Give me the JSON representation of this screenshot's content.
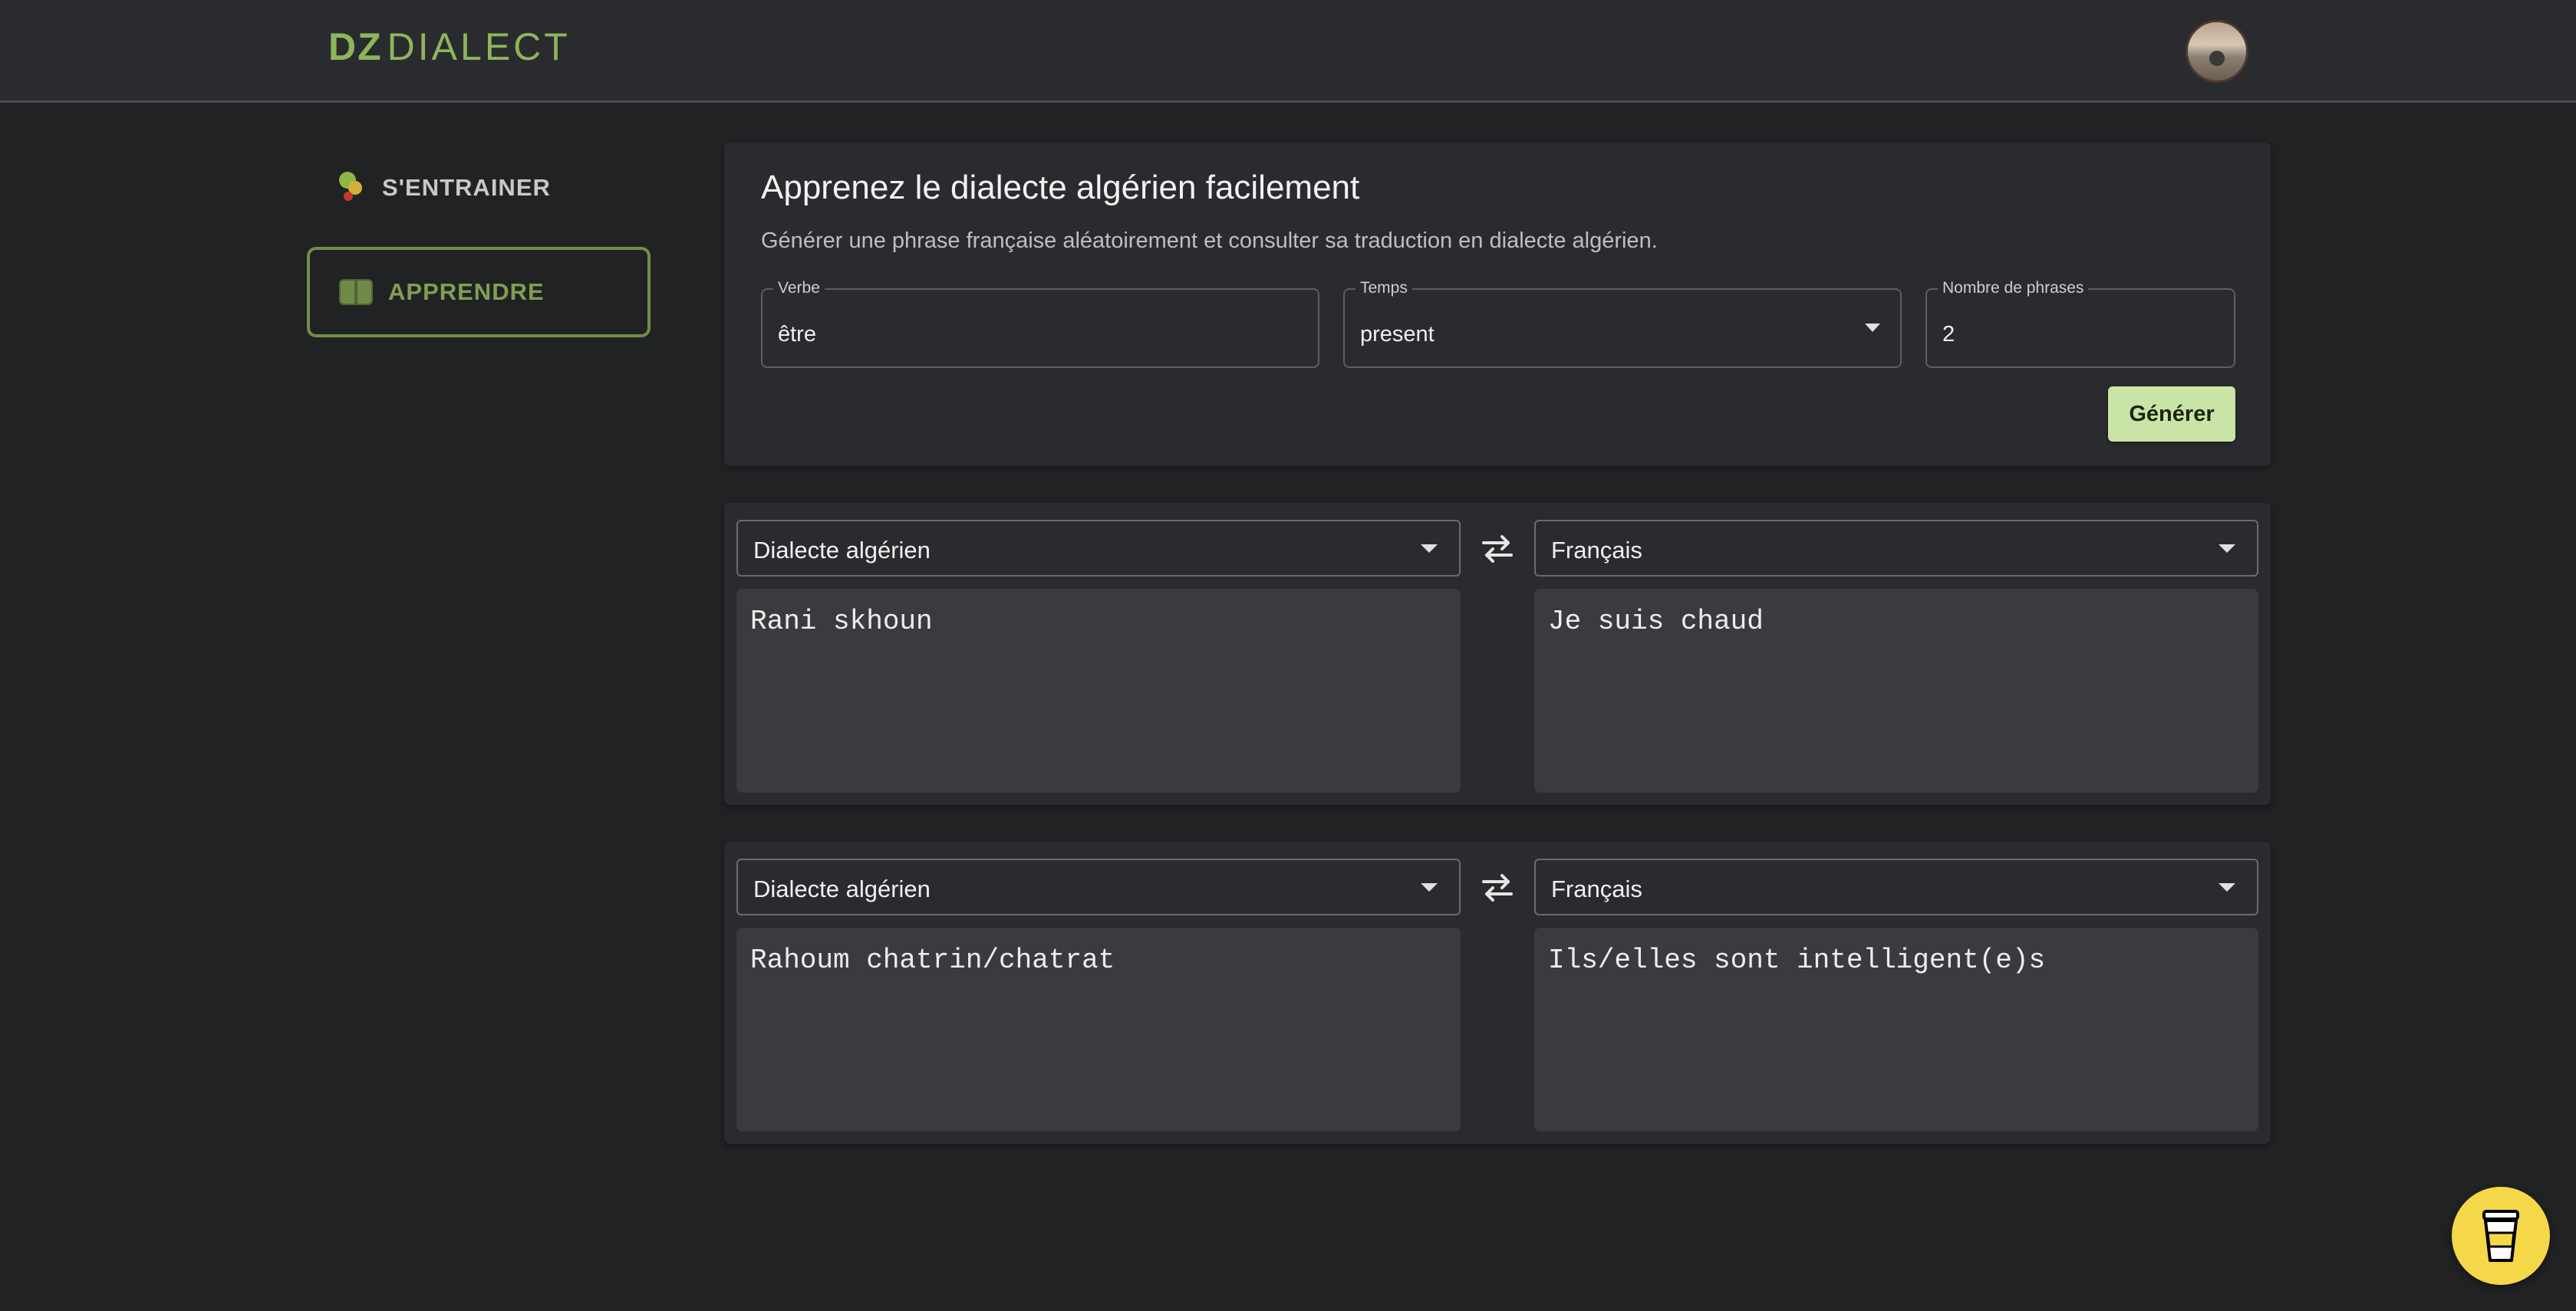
{
  "header": {
    "logo_dz": "DZ",
    "logo_dialect": "DIALECT",
    "avatar": "user-avatar"
  },
  "sidebar": {
    "items": [
      {
        "label": "S'ENTRAINER",
        "icon": "dots-icon",
        "active": false
      },
      {
        "label": "APPRENDRE",
        "icon": "book-icon",
        "active": true
      }
    ]
  },
  "generator": {
    "title": "Apprenez le dialecte algérien facilement",
    "subtitle": "Générer une phrase française aléatoirement et consulter sa traduction en dialecte algérien.",
    "verbe": {
      "label": "Verbe",
      "value": "être"
    },
    "temps": {
      "label": "Temps",
      "value": "present"
    },
    "nombre": {
      "label": "Nombre de phrases",
      "value": "2"
    },
    "button": "Générer"
  },
  "translations": [
    {
      "source_lang": "Dialecte algérien",
      "target_lang": "Français",
      "source_text": "Rani skhoun",
      "target_text": "Je suis chaud"
    },
    {
      "source_lang": "Dialecte algérien",
      "target_lang": "Français",
      "source_text": "Rahoum chatrin/chatrat",
      "target_text": "Ils/elles sont intelligent(e)s"
    }
  ],
  "colors": {
    "background": "#212224",
    "panel": "#2a2b2e",
    "accent_green": "#8db55a",
    "button_green": "#c9e4a6",
    "coffee_yellow": "#f5d84a"
  },
  "floating_button": {
    "icon": "coffee-cup-icon"
  }
}
